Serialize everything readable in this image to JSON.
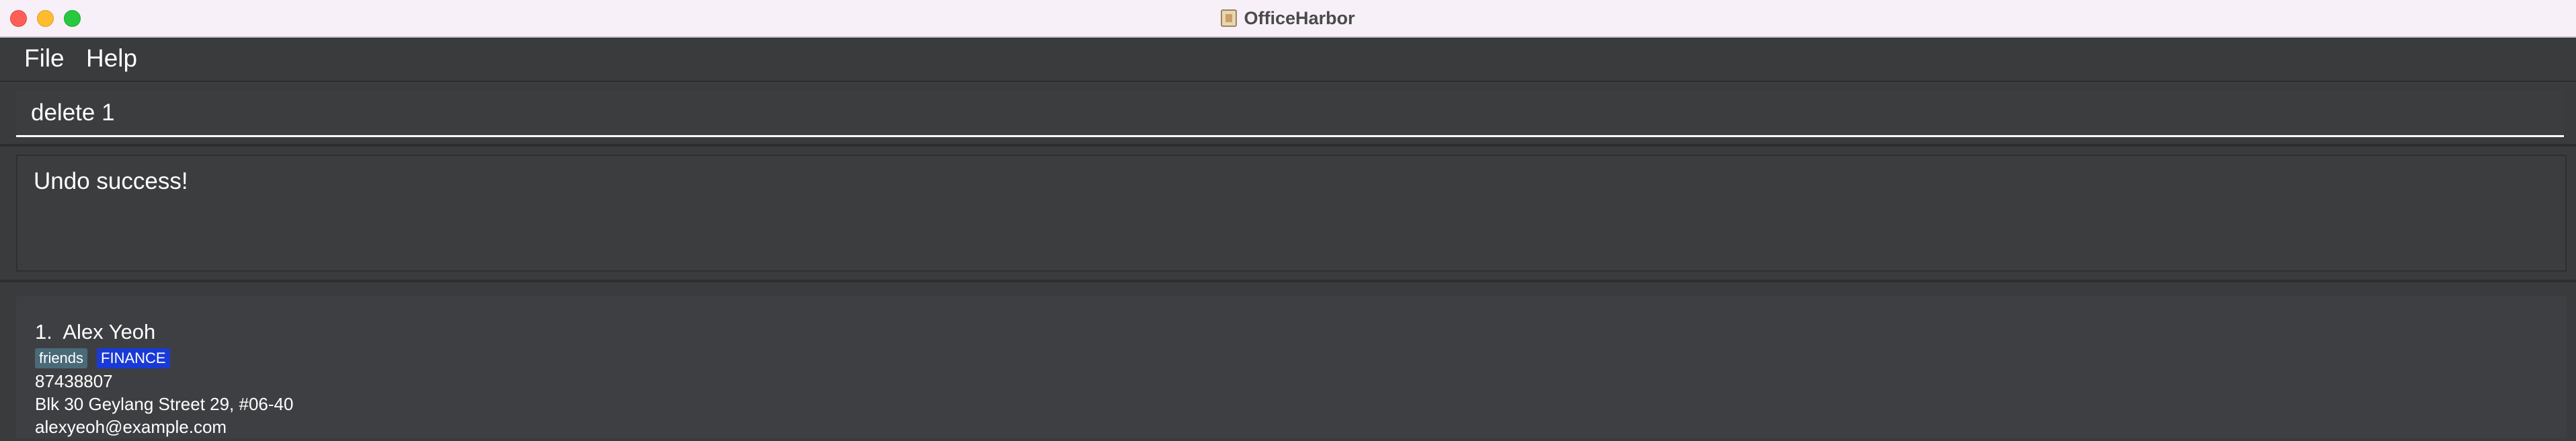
{
  "window": {
    "title": "OfficeHarbor",
    "app_icon": "office-harbor-icon"
  },
  "menu": {
    "file_label": "File",
    "help_label": "Help"
  },
  "command": {
    "value": "delete 1"
  },
  "result": {
    "message": "Undo success!"
  },
  "persons": [
    {
      "index": "1.",
      "name": "Alex Yeoh",
      "tags": [
        {
          "label": "friends",
          "color": "#4a6a78"
        },
        {
          "label": "FINANCE",
          "color": "#1a3ad6"
        }
      ],
      "phone": "87438807",
      "address": "Blk 30 Geylang Street 29, #06-40",
      "email": "alexyeoh@example.com"
    }
  ]
}
